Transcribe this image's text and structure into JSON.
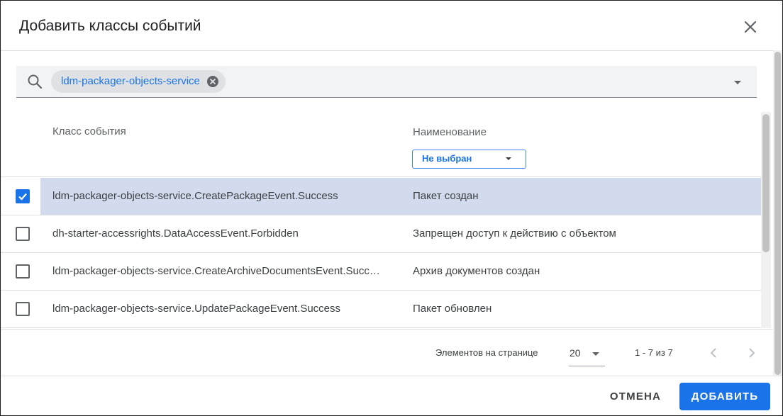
{
  "dialog": {
    "title": "Добавить классы событий"
  },
  "search": {
    "chips": [
      {
        "label": "ldm-packager-objects-service"
      }
    ]
  },
  "table": {
    "columns": {
      "event_class": "Класс события",
      "name": "Наименование"
    },
    "name_filter": {
      "selected": "Не выбран"
    },
    "rows": [
      {
        "event_class": "ldm-packager-objects-service.CreatePackageEvent.Success",
        "name": "Пакет создан",
        "checked": true
      },
      {
        "event_class": "dh-starter-accessrights.DataAccessEvent.Forbidden",
        "name": "Запрещен доступ к действию с объектом",
        "checked": false
      },
      {
        "event_class": "ldm-packager-objects-service.CreateArchiveDocumentsEvent.Success",
        "name": "Архив документов создан",
        "checked": false
      },
      {
        "event_class": "ldm-packager-objects-service.UpdatePackageEvent.Success",
        "name": "Пакет обновлен",
        "checked": false
      }
    ]
  },
  "paginator": {
    "per_page_label": "Элементов на странице",
    "per_page_value": "20",
    "range_label": "1 - 7 из 7"
  },
  "actions": {
    "cancel_label": "ОТМЕНА",
    "add_label": "ДОБАВИТЬ"
  },
  "colors": {
    "accent": "#1a73e8",
    "selected_row": "#d2dbed"
  },
  "icons": {
    "close": "close-icon",
    "search": "search-icon",
    "chip_remove": "cancel-circle-icon",
    "dropdown": "arrow-drop-down-icon",
    "checkbox_checked": "check-icon",
    "prev": "chevron-left-icon",
    "next": "chevron-right-icon"
  }
}
